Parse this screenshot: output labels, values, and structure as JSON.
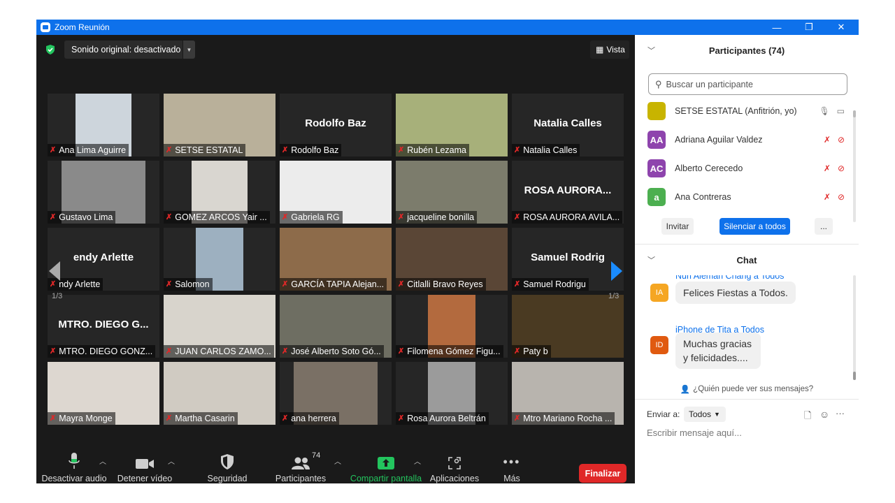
{
  "window": {
    "title": "Zoom Reunión",
    "minimize": "—",
    "restore": "❐",
    "close": "✕"
  },
  "top": {
    "sound_label": "Sonido original: desactivado",
    "view_label": "Vista"
  },
  "grid": {
    "page_left": "1/3",
    "page_right": "1/3",
    "tiles": [
      {
        "name": "Ana Lima Aguirre",
        "big": ""
      },
      {
        "name": "SETSE ESTATAL",
        "big": ""
      },
      {
        "name": "Rodolfo Baz",
        "big": "Rodolfo Baz"
      },
      {
        "name": "Rubén Lezama",
        "big": ""
      },
      {
        "name": "Natalia Calles",
        "big": "Natalia Calles"
      },
      {
        "name": "Gustavo Lima",
        "big": ""
      },
      {
        "name": "GOMEZ ARCOS Yair ...",
        "big": ""
      },
      {
        "name": "Gabriela RG",
        "big": ""
      },
      {
        "name": "jacqueline bonilla",
        "big": ""
      },
      {
        "name": "ROSA AURORA AVILA...",
        "big": "ROSA AURORA..."
      },
      {
        "name": "ndy  Arlette",
        "big": "endy  Arlette"
      },
      {
        "name": "Salomon",
        "big": ""
      },
      {
        "name": "GARCÍA TAPIA Alejan...",
        "big": ""
      },
      {
        "name": "Citlalli Bravo Reyes",
        "big": ""
      },
      {
        "name": "Samuel Rodrigu",
        "big": "Samuel Rodrig"
      },
      {
        "name": "MTRO. DIEGO GONZ...",
        "big": "MTRO. DIEGO G..."
      },
      {
        "name": "JUAN CARLOS ZAMO...",
        "big": ""
      },
      {
        "name": "José Alberto Soto Gó...",
        "big": ""
      },
      {
        "name": "Filomena Gómez Figu...",
        "big": ""
      },
      {
        "name": "Paty b",
        "big": ""
      },
      {
        "name": "Mayra Monge",
        "big": ""
      },
      {
        "name": "Martha Casarin",
        "big": ""
      },
      {
        "name": "ana herrera",
        "big": ""
      },
      {
        "name": "Rosa Aurora Beltrán",
        "big": ""
      },
      {
        "name": "Mtro Mariano Rocha ...",
        "big": ""
      }
    ]
  },
  "toolbar": {
    "mute": "Desactivar audio",
    "video": "Detener vídeo",
    "security": "Seguridad",
    "participants": "Participantes",
    "participants_count": "74",
    "share": "Compartir pantalla",
    "apps": "Aplicaciones",
    "more": "Más",
    "end": "Finalizar"
  },
  "participants_panel": {
    "title": "Participantes (74)",
    "search_placeholder": "Buscar un participante",
    "rows": [
      {
        "initials": "",
        "name": "SETSE ESTATAL (Anfitrión, yo)",
        "color": "#c8b400"
      },
      {
        "initials": "AA",
        "name": "Adriana Aguilar Valdez",
        "color": "#8e44ad"
      },
      {
        "initials": "AC",
        "name": "Alberto Cerecedo",
        "color": "#8e44ad"
      },
      {
        "initials": "a",
        "name": "Ana Contreras",
        "color": "#4caf50"
      }
    ],
    "invite": "Invitar",
    "mute_all": "Silenciar a todos",
    "more": "..."
  },
  "chat": {
    "title": "Chat",
    "cut_sender": "Nuri Aleman Chang a Todos",
    "messages": [
      {
        "initials": "IA",
        "color": "#f5a623",
        "sender": "",
        "text": "Felices Fiestas a Todos."
      },
      {
        "initials": "ID",
        "color": "#e05a10",
        "sender": "iPhone de Tita a Todos",
        "text": "Muchas gracias y felicidades...."
      }
    ],
    "who_sees": "¿Quién puede ver sus mensajes?",
    "send_to_label": "Enviar a:",
    "send_to_value": "Todos",
    "input_placeholder": "Escribir mensaje aquí..."
  }
}
